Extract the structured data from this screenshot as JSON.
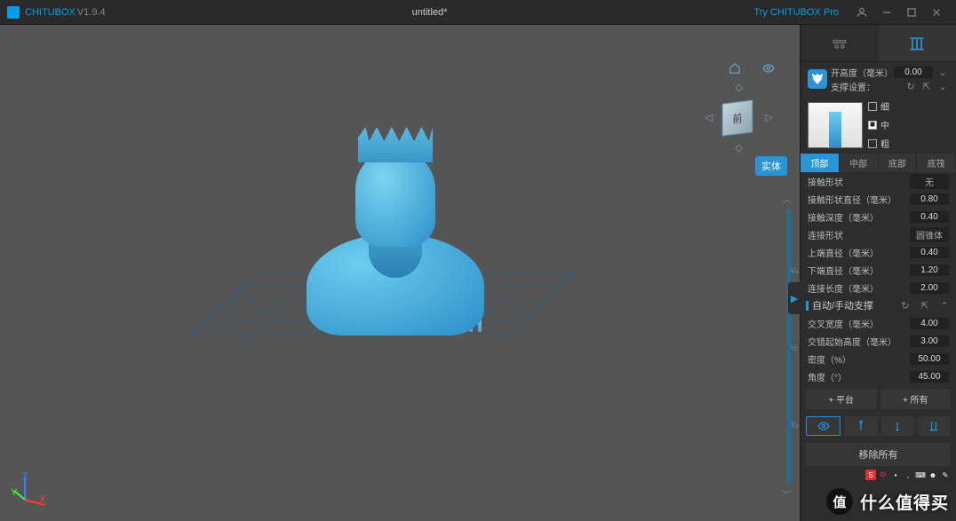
{
  "titlebar": {
    "app_name": "CHITUBOX",
    "version": "V1.9.4",
    "document": "untitled*",
    "try_pro": "Try CHITUBOX Pro"
  },
  "viewport": {
    "cube_face": "前",
    "solid_mode": "实体",
    "zoom_marks": [
      "¼",
      "½",
      "¾"
    ]
  },
  "axis": {
    "x": "X",
    "y": "Y",
    "z": "Z"
  },
  "support_panel": {
    "z_lift": {
      "label": "开高度（毫米）",
      "value": "0.00"
    },
    "settings_label": "支撑设置：",
    "presets": {
      "thin": "细",
      "medium": "中",
      "thick": "粗"
    },
    "tabs": [
      "顶部",
      "中部",
      "底部",
      "底筏"
    ],
    "active_tab": 0,
    "params": [
      {
        "label": "接触形状",
        "value": "无",
        "type": "select"
      },
      {
        "label": "接触形状直径（毫米）",
        "value": "0.80"
      },
      {
        "label": "接触深度（毫米）",
        "value": "0.40"
      },
      {
        "label": "连接形状",
        "value": "圆锥体",
        "type": "select"
      },
      {
        "label": "上端直径（毫米）",
        "value": "0.40"
      },
      {
        "label": "下端直径（毫米）",
        "value": "1.20"
      },
      {
        "label": "连接长度（毫米）",
        "value": "2.00"
      }
    ],
    "auto_section": "自动/手动支撑",
    "auto_params": [
      {
        "label": "交叉宽度（毫米）",
        "value": "4.00"
      },
      {
        "label": "交错起始高度（毫米）",
        "value": "3.00"
      },
      {
        "label": "密度（%）",
        "value": "50.00"
      },
      {
        "label": "角度（°）",
        "value": "45.00"
      }
    ],
    "buttons": {
      "platform": "+ 平台",
      "all": "+ 所有"
    },
    "remove_all": "移除所有"
  },
  "brand": {
    "badge": "值",
    "text": "什么值得买"
  }
}
